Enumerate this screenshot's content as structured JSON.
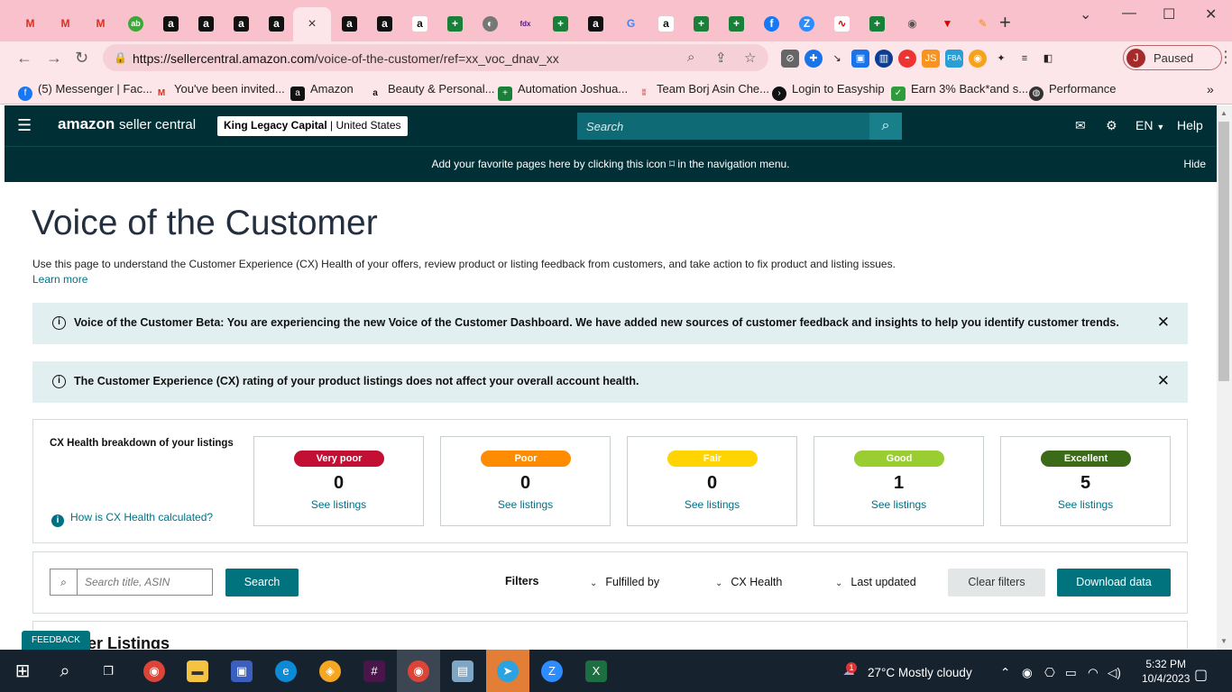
{
  "browser": {
    "url_host": "https://sellercentral.amazon.com",
    "url_path": "/voice-of-the-customer/ref=xx_voc_dnav_xx",
    "profile_initial": "J",
    "profile_status": "Paused",
    "tab_close": "×",
    "new_tab": "+",
    "bookmarks": [
      {
        "label": "(5) Messenger | Fac...",
        "icon": "messenger-icon"
      },
      {
        "label": "You've been invited...",
        "icon": "gmail-icon"
      },
      {
        "label": "Amazon",
        "icon": "amazon-icon"
      },
      {
        "label": "Beauty & Personal...",
        "icon": "amazon-smile-icon"
      },
      {
        "label": "Automation Joshua...",
        "icon": "sheets-icon"
      },
      {
        "label": "Team Borj Asin Che...",
        "icon": "team-icon"
      },
      {
        "label": "Login to Easyship",
        "icon": "easyship-icon"
      },
      {
        "label": "Earn 3% Back*and s...",
        "icon": "cashback-icon"
      },
      {
        "label": "Performance",
        "icon": "globe-icon"
      }
    ]
  },
  "header": {
    "logo_text": "amazon",
    "logo_suffix": "seller central",
    "account_name": "King Legacy Capital",
    "account_region": "United States",
    "search_placeholder": "Search",
    "language": "EN",
    "help": "Help"
  },
  "banner": {
    "message": "Add your favorite pages here by clicking this icon ⌑ in the navigation menu.",
    "hide": "Hide"
  },
  "page": {
    "title": "Voice of the Customer",
    "intro": "Use this page to understand the Customer Experience (CX) Health of your offers, review product or listing feedback from customers, and take action to fix product and listing issues.",
    "learn_more": "Learn more",
    "alerts": [
      "Voice of the Customer Beta: You are experiencing the new Voice of the Customer Dashboard. We have added new sources of customer feedback and insights to help you identify customer trends.",
      "The Customer Experience (CX) rating of your product listings does not affect your overall account health."
    ]
  },
  "cx_health": {
    "title": "CX Health breakdown of your listings",
    "how_link": "How is CX Health calculated?",
    "cards": [
      {
        "label": "Very poor",
        "count": "0",
        "link": "See listings",
        "color": "#c40f34",
        "text_color": "#ffffff"
      },
      {
        "label": "Poor",
        "count": "0",
        "link": "See listings",
        "color": "#ff8c00",
        "text_color": "#ffffff"
      },
      {
        "label": "Fair",
        "count": "0",
        "link": "See listings",
        "color": "#ffd400",
        "text_color": "#ffffff"
      },
      {
        "label": "Good",
        "count": "1",
        "link": "See listings",
        "color": "#9acd32",
        "text_color": "#ffffff"
      },
      {
        "label": "Excellent",
        "count": "5",
        "link": "See listings",
        "color": "#3b6b17",
        "text_color": "#ffffff"
      }
    ]
  },
  "filters": {
    "search_placeholder": "Search title, ASIN",
    "search_button": "Search",
    "filters_label": "Filters",
    "dropdowns": [
      "Fulfilled by",
      "CX Health",
      "Last updated"
    ],
    "clear": "Clear filters",
    "download": "Download data"
  },
  "listings": {
    "title": "er Listings"
  },
  "feedback": "FEEDBACK ✕",
  "taskbar": {
    "weather": "27°C  Mostly cloudy",
    "time": "5:32 PM",
    "date": "10/4/2023",
    "badge": "1"
  }
}
